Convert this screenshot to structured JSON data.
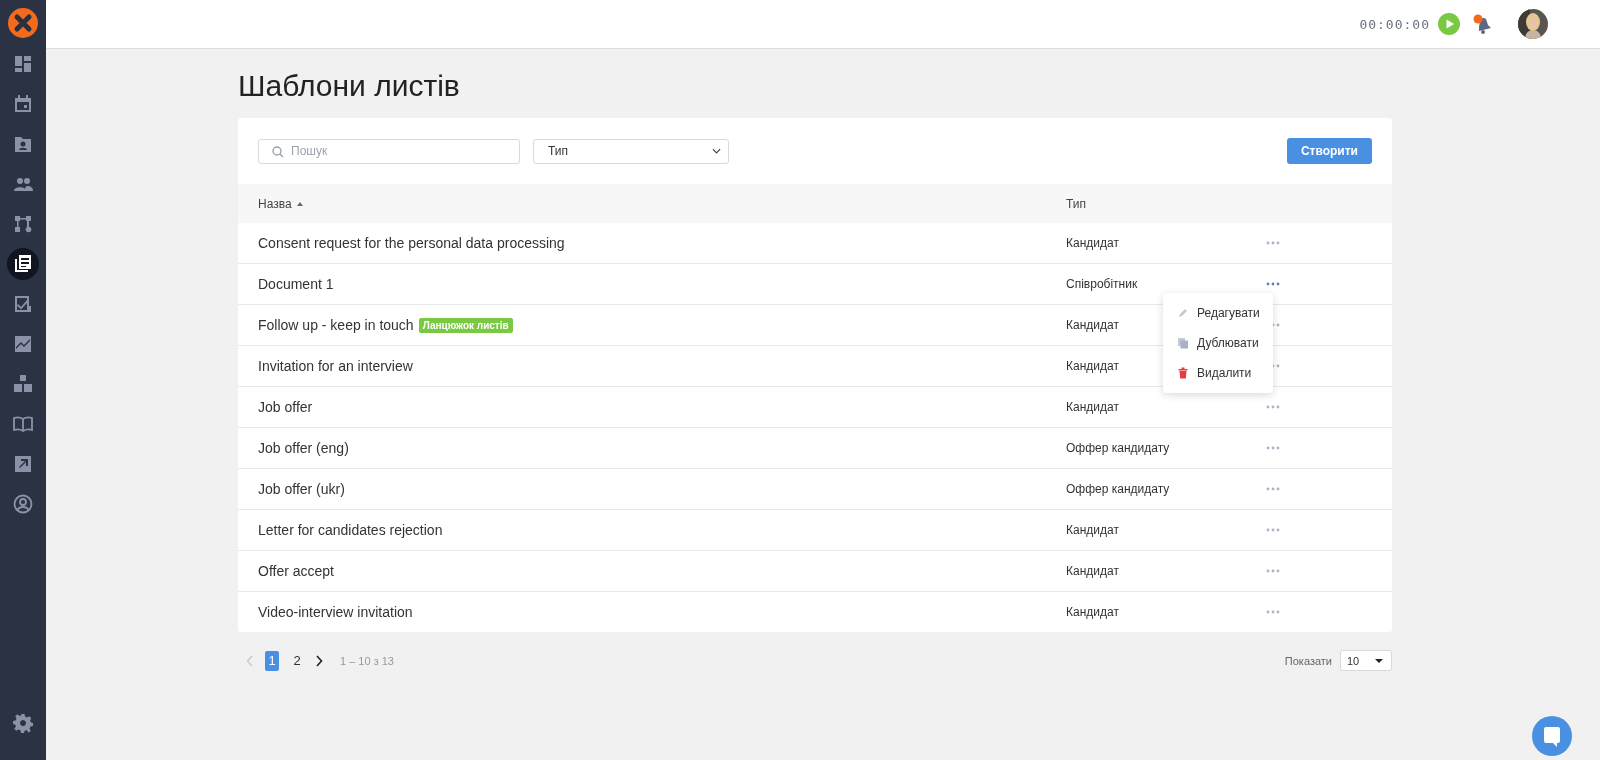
{
  "sidebar": {
    "items": [
      {
        "kind": "dashboard",
        "selected": false
      },
      {
        "kind": "calendar",
        "selected": false
      },
      {
        "kind": "contact",
        "selected": false
      },
      {
        "kind": "people",
        "selected": false
      },
      {
        "kind": "flow",
        "selected": false
      },
      {
        "kind": "documents",
        "selected": true
      },
      {
        "kind": "tasks",
        "selected": false
      },
      {
        "kind": "chart",
        "selected": false
      },
      {
        "kind": "boxes",
        "selected": false
      },
      {
        "kind": "book",
        "selected": false
      },
      {
        "kind": "export",
        "selected": false
      },
      {
        "kind": "profile",
        "selected": false
      }
    ]
  },
  "topbar": {
    "timer": "00:00:00",
    "notification": true
  },
  "page_title": "Шаблони листів",
  "toolbar": {
    "search": {
      "placeholder": "Пошук"
    },
    "type_filter": {
      "value": "Тип"
    },
    "create_button": "Створити"
  },
  "table": {
    "columns": [
      {
        "label": "Назва",
        "sorted": true
      },
      {
        "label": "Тип"
      }
    ],
    "rows": [
      {
        "name": "Consent request for the personal data processing",
        "type": "Кандидат",
        "menu_open": false
      },
      {
        "name": "Document 1",
        "type": "Співробітник",
        "menu_open": true
      },
      {
        "name": "Follow up - keep in touch",
        "tag": "Ланцюжок листів",
        "type": "Кандидат",
        "menu_open": false
      },
      {
        "name": "Invitation for an interview",
        "type": "Кандидат",
        "menu_open": false
      },
      {
        "name": "Job offer",
        "type": "Кандидат",
        "menu_open": false
      },
      {
        "name": "Job offer (eng)",
        "type": "Оффер кандидату",
        "menu_open": false
      },
      {
        "name": "Job offer (ukr)",
        "type": "Оффер кандидату",
        "menu_open": false
      },
      {
        "name": "Letter for candidates rejection",
        "type": "Кандидат",
        "menu_open": false
      },
      {
        "name": "Offer accept",
        "type": "Кандидат",
        "menu_open": false
      },
      {
        "name": "Video-interview invitation",
        "type": "Кандидат",
        "menu_open": false
      }
    ]
  },
  "row_menu": {
    "items": [
      {
        "kind": "edit",
        "label": "Редагувати"
      },
      {
        "kind": "duplicate",
        "label": "Дублювати"
      },
      {
        "kind": "delete",
        "label": "Видалити"
      }
    ]
  },
  "pagination": {
    "prev": {
      "disabled": true
    },
    "next": {
      "disabled": false
    },
    "pages": [
      {
        "label": "1",
        "selected": true
      },
      {
        "label": "2",
        "selected": false
      }
    ],
    "range": "1 – 10 з 13",
    "page_size_label": "Показати",
    "page_size": "10"
  }
}
